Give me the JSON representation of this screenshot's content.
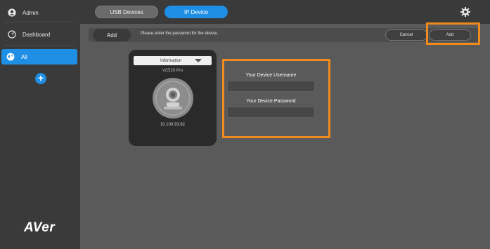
{
  "sidebar": {
    "admin_label": "Admin",
    "dashboard_label": "Dashboard",
    "all_label": "All",
    "add_symbol": "+",
    "logo_text": "AVer"
  },
  "tabs": [
    {
      "label": "USB Devices",
      "active": false
    },
    {
      "label": "IP Device",
      "active": true
    }
  ],
  "actionbar": {
    "add_label": "Add",
    "prompt": "Please enter the password for the device.",
    "cancel_label": "Cancel",
    "add_right_label": "Add"
  },
  "device_card": {
    "header": "Information",
    "model": "VC520 Pro",
    "ip": "10.100.93.62"
  },
  "form": {
    "username_label": "Your Device Username",
    "password_label": "Your Device Password",
    "username_value": "",
    "password_value": ""
  },
  "colors": {
    "accent": "#1f8fe6",
    "highlight": "#f08a1c",
    "background": "#5a5a5a",
    "sidebar": "#3a3a3a"
  },
  "icons": [
    "user-icon",
    "dashboard-gauge-icon",
    "globe-icon",
    "plus-icon",
    "gear-icon",
    "camera-icon",
    "dropdown-triangle-icon"
  ]
}
